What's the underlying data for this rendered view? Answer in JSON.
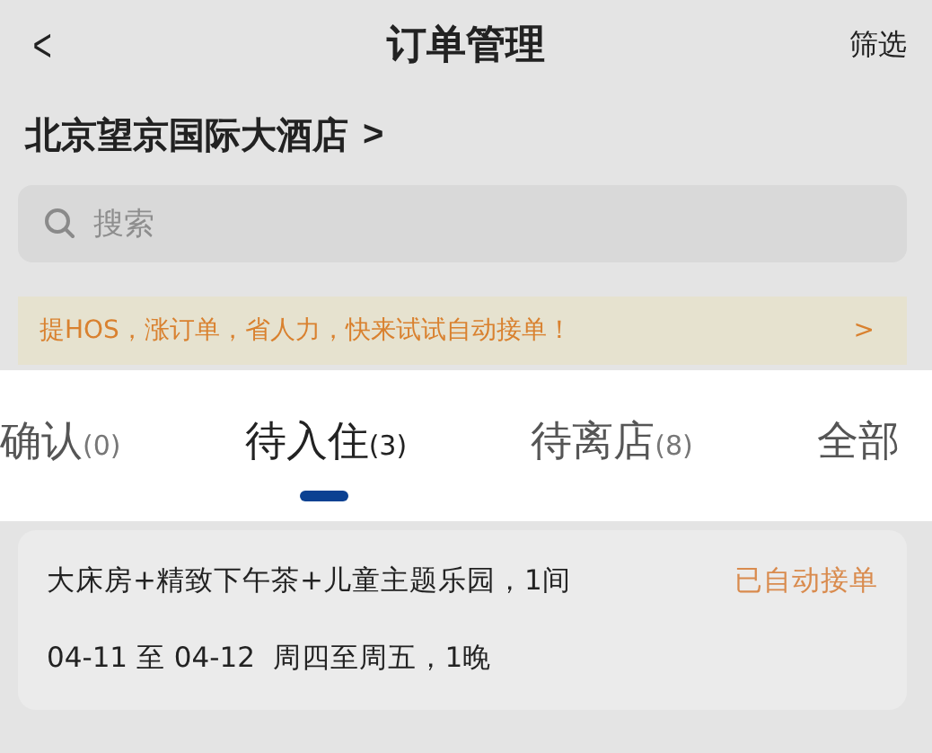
{
  "header": {
    "back": "<",
    "title": "订单管理",
    "action": "筛选"
  },
  "hotel": {
    "name": "北京望京国际大酒店",
    "chevron": ">"
  },
  "search": {
    "placeholder": "搜索"
  },
  "banner": {
    "text": "提HOS，涨订单，省人力，快来试试自动接单！",
    "chevron": ">"
  },
  "tabs": [
    {
      "label": "确认",
      "count": "(0)",
      "selected": false
    },
    {
      "label": "待入住",
      "count": "(3)",
      "selected": true
    },
    {
      "label": "待离店",
      "count": "(8)",
      "selected": false
    },
    {
      "label": "全部",
      "selected": false
    }
  ],
  "orders": [
    {
      "room": "大床房+精致下午茶+儿童主题乐园，1间",
      "status": "已自动接单",
      "dates": "04-11 至 04-12  周四至周五，1晚"
    }
  ]
}
